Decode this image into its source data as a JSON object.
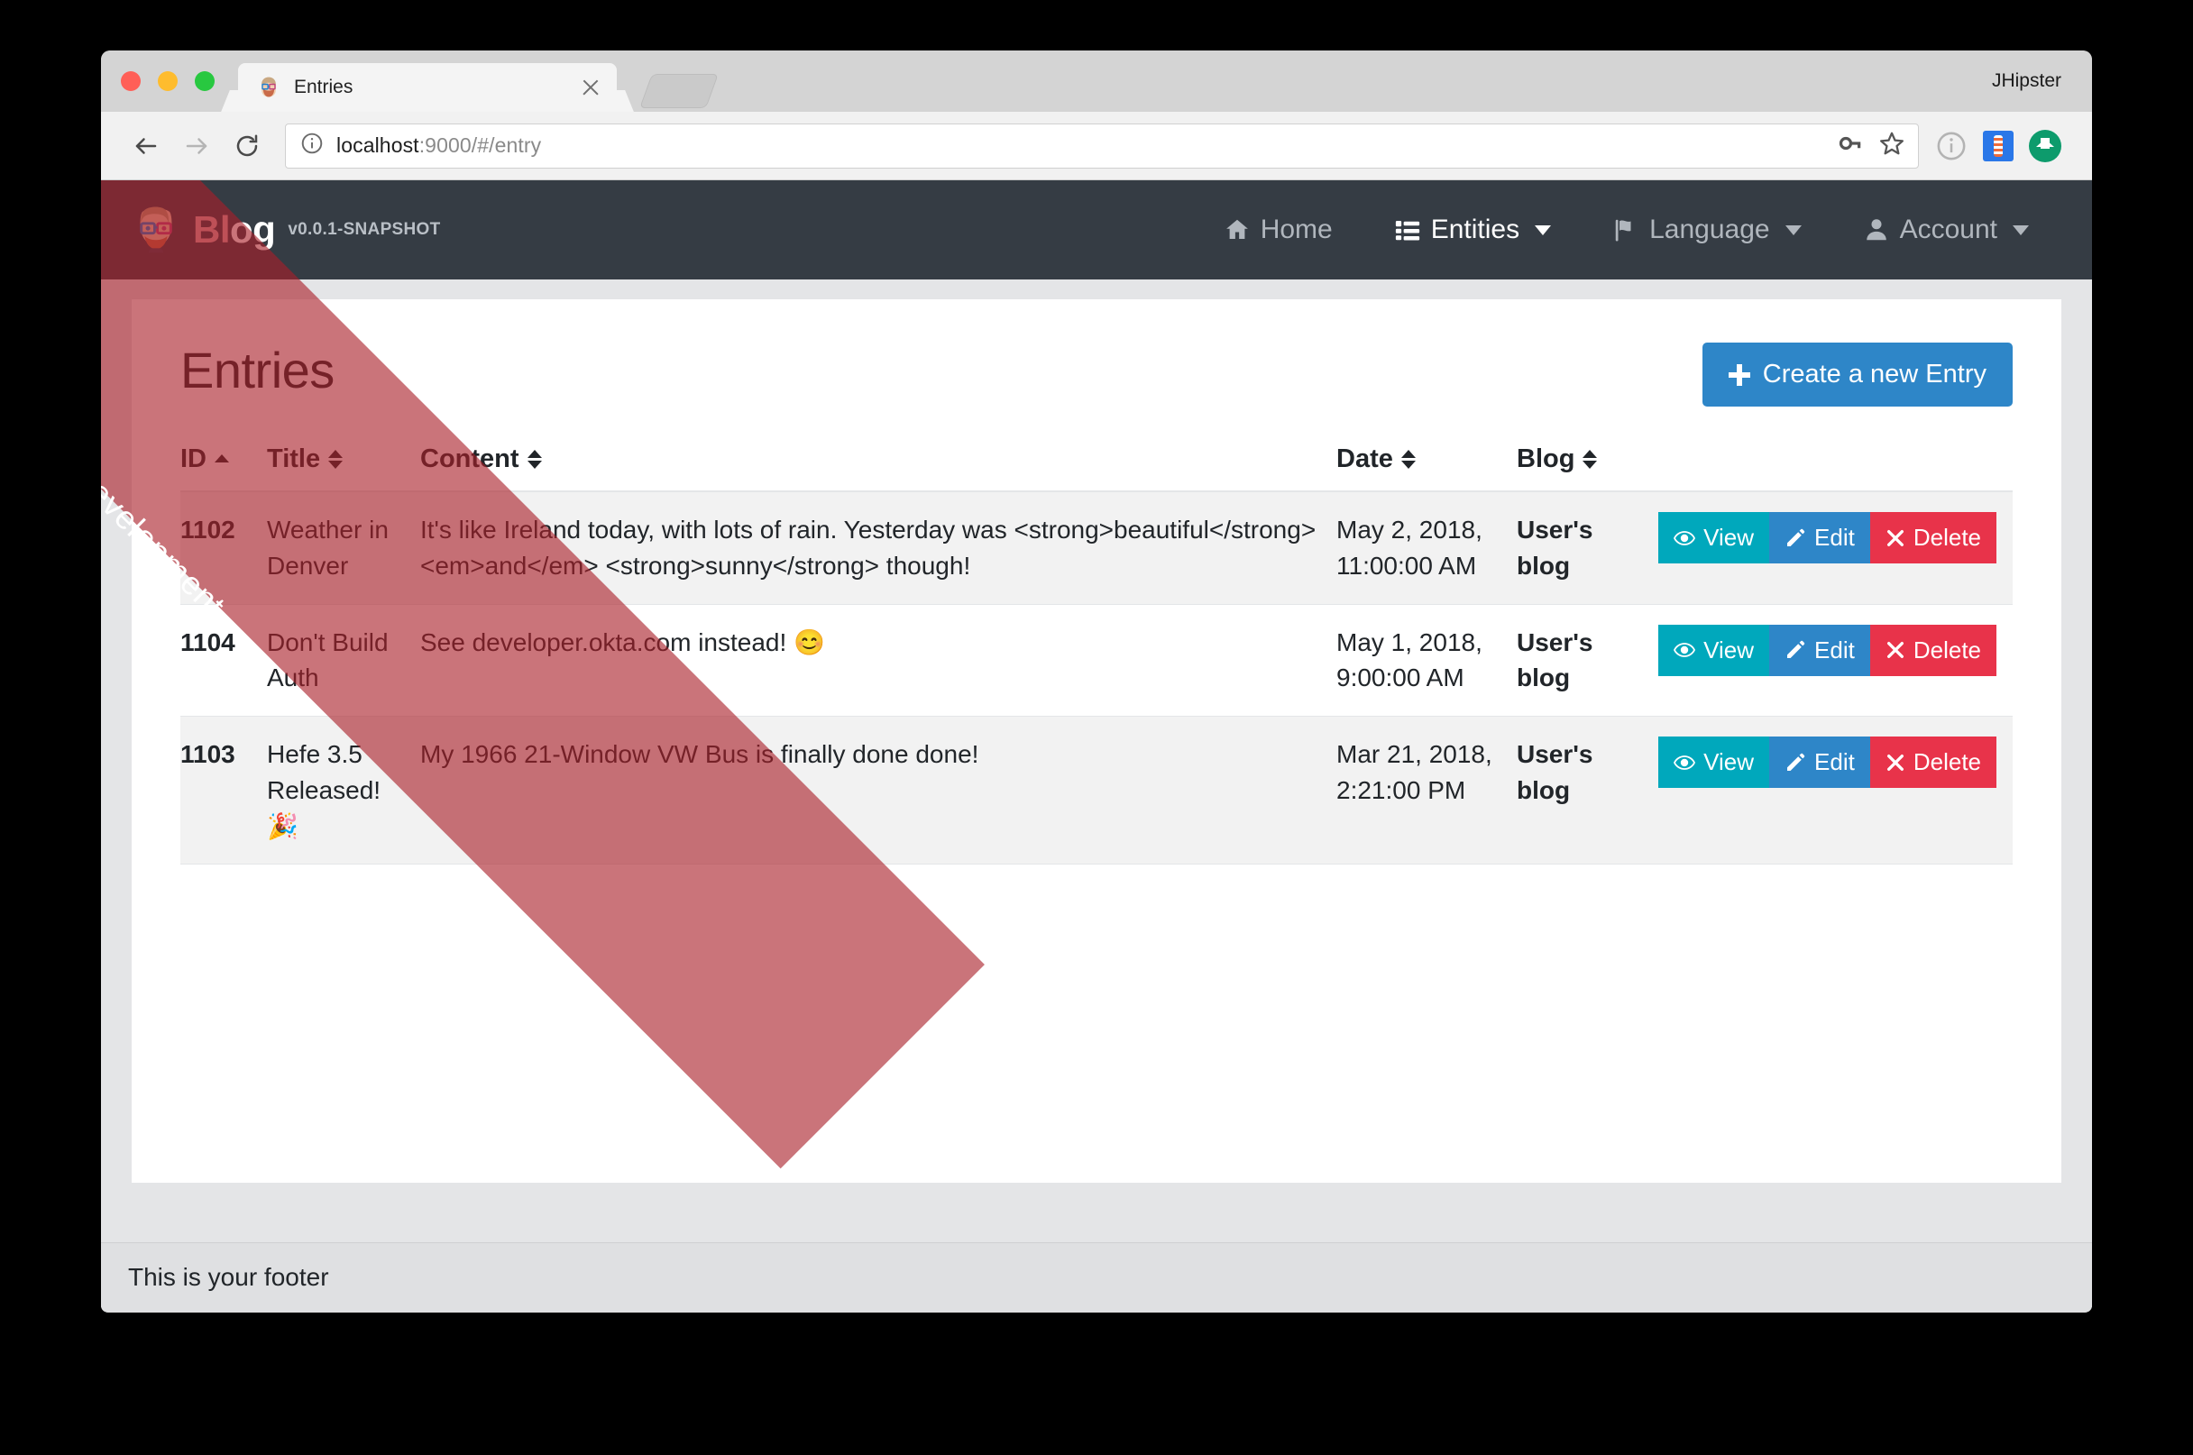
{
  "browser": {
    "tab": {
      "title": "Entries",
      "favicon": "jhipster-avatar-icon",
      "close": "close-icon"
    },
    "new_tab_label": "",
    "profile_name": "JHipster",
    "toolbar": {
      "back": "back-arrow-icon",
      "forward": "forward-arrow-icon",
      "reload": "reload-icon",
      "info": "info-circle-icon",
      "url_host": "localhost",
      "url_rest": ":9000/#/entry",
      "url_full": "localhost:9000/#/entry",
      "key_icon": "key-icon",
      "star_icon": "star-icon",
      "ext_info": "info-circle-icon",
      "ext_lighthouse": "lighthouse-icon",
      "ext_green": "upload-circle-icon"
    }
  },
  "ribbon": {
    "label": "Development",
    "color": "#aa1e28"
  },
  "navbar": {
    "brand_part1": "Bl",
    "brand_part2": "og",
    "version": "v0.0.1-SNAPSHOT",
    "logo_icon": "jhipster-avatar-icon",
    "items": [
      {
        "label": "Home",
        "icon": "home-icon",
        "caret": false,
        "active": false
      },
      {
        "label": "Entities",
        "icon": "list-icon",
        "caret": true,
        "active": true
      },
      {
        "label": "Language",
        "icon": "flag-icon",
        "caret": true,
        "active": false
      },
      {
        "label": "Account",
        "icon": "user-icon",
        "caret": true,
        "active": false
      }
    ]
  },
  "page": {
    "title": "Entries",
    "create_button": "Create a new Entry"
  },
  "table": {
    "headers": [
      {
        "label": "ID",
        "sort": "asc"
      },
      {
        "label": "Title",
        "sort": "none"
      },
      {
        "label": "Content",
        "sort": "none"
      },
      {
        "label": "Date",
        "sort": "none"
      },
      {
        "label": "Blog",
        "sort": "none"
      }
    ],
    "actions": {
      "view": "View",
      "edit": "Edit",
      "delete": "Delete",
      "view_icon": "eye-icon",
      "edit_icon": "pencil-icon",
      "delete_icon": "times-icon"
    },
    "rows": [
      {
        "id": "1102",
        "title": "Weather in Denver",
        "content": "It's like Ireland today, with lots of rain. Yesterday was <strong>beautiful</strong> <em>and</em> <strong>sunny</strong> though!",
        "date": "May 2, 2018, 11:00:00 AM",
        "blog": "User's blog"
      },
      {
        "id": "1104",
        "title": "Don't Build Auth",
        "content": "See developer.okta.com instead! 😊",
        "date": "May 1, 2018, 9:00:00 AM",
        "blog": "User's blog"
      },
      {
        "id": "1103",
        "title": "Hefe 3.5 Released! 🎉",
        "content": "My 1966 21-Window VW Bus is finally done done!",
        "date": "Mar 21, 2018, 2:21:00 PM",
        "blog": "User's blog"
      }
    ]
  },
  "footer": {
    "text": "This is your footer"
  }
}
